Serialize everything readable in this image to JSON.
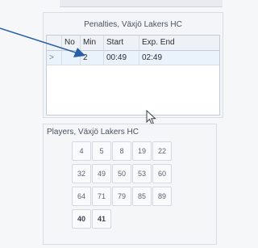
{
  "penalties": {
    "title": "Penalties, Växjö Lakers HC",
    "columns": {
      "no": "No",
      "min": "Min",
      "start": "Start",
      "end": "Exp. End"
    },
    "rows": [
      {
        "selector": ">",
        "no": "",
        "min": "2",
        "start": "00:49",
        "end": "02:49"
      }
    ]
  },
  "players": {
    "title": "Players, Växjö Lakers HC",
    "numbers": [
      "4",
      "5",
      "8",
      "19",
      "22",
      "32",
      "49",
      "50",
      "53",
      "60",
      "64",
      "71",
      "79",
      "85",
      "89",
      "40",
      "41"
    ]
  },
  "colors": {
    "annotation": "#2b5ea8",
    "row_highlight": "#eaf2fb"
  }
}
